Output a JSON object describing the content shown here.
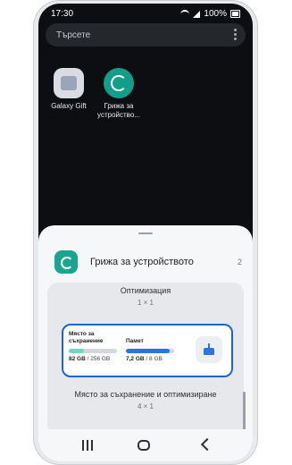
{
  "status": {
    "time": "17:30",
    "battery": "100%"
  },
  "search": {
    "placeholder": "Търсете"
  },
  "apps": [
    {
      "label": "Galaxy Gift",
      "icon": "gift-box-icon"
    },
    {
      "label": "Грижа за устройство...",
      "icon": "device-care-icon"
    }
  ],
  "sheet": {
    "title": "Грижа за устройството",
    "count": "2",
    "widgets": [
      {
        "name": "Оптимизация",
        "size": "1 × 1"
      },
      {
        "name": "Място за съхранение и оптимизиране",
        "size": "4 × 1"
      }
    ],
    "preview": {
      "storage_label": "Място за съхранение",
      "storage_used": "82 GB",
      "storage_total": "/ 256 GB",
      "storage_fraction": 0.32,
      "memory_label": "Памет",
      "memory_used": "7,2 GB",
      "memory_total": "/ 8 GB",
      "memory_fraction": 0.9,
      "action_icon": "clean-broom-icon"
    }
  },
  "navbar": {
    "recent": "recents-icon",
    "home": "home-icon",
    "back": "back-icon"
  },
  "colors": {
    "accent": "#1d63d8",
    "care": "#19a58f"
  }
}
